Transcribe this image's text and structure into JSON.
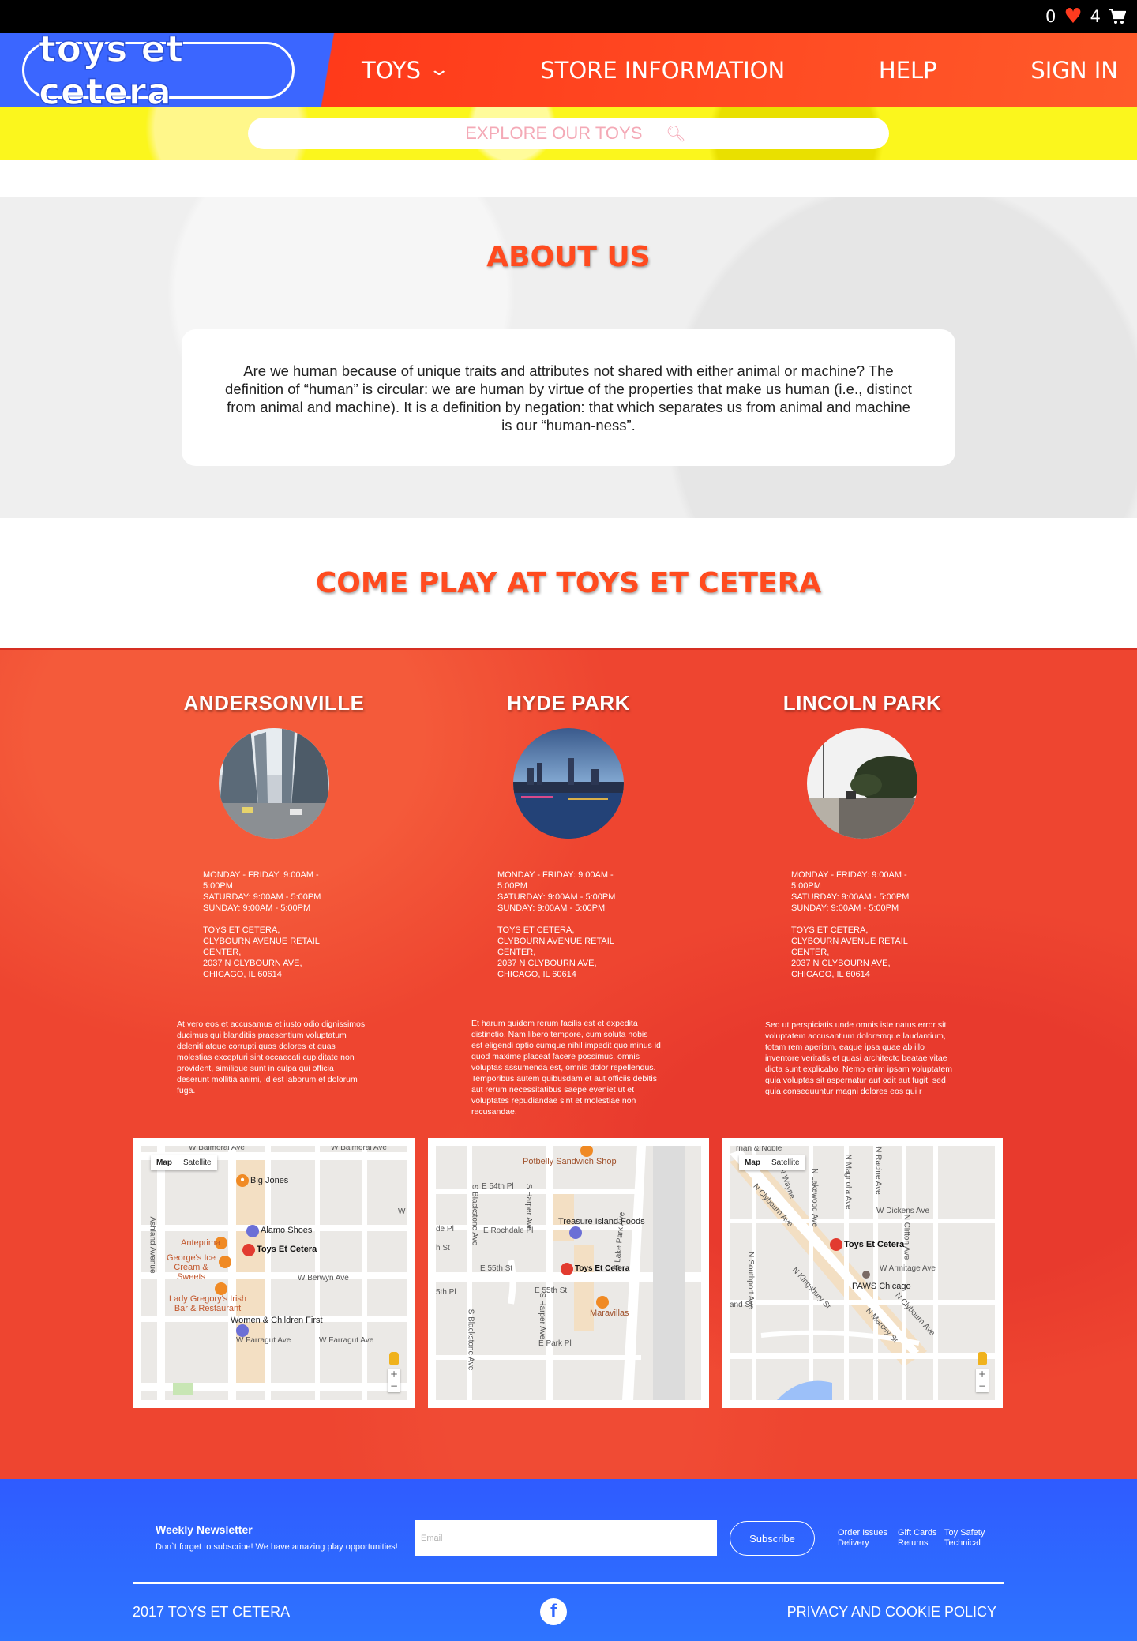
{
  "topbar": {
    "wishlist_count": "0",
    "cart_count": "4",
    "heart_icon": "heart-icon",
    "cart_icon": "cart-icon"
  },
  "header": {
    "logo_text": "toys et cetera",
    "nav": [
      {
        "label": "TOYS",
        "has_dropdown": true
      },
      {
        "label": "STORE INFORMATION"
      },
      {
        "label": "HELP"
      },
      {
        "label": "SIGN IN"
      }
    ],
    "colors": {
      "blue": "#3b66ff",
      "red": "#ff3a1a"
    }
  },
  "search": {
    "placeholder": "EXPLORE OUR TOYS"
  },
  "about": {
    "title": "ABOUT US",
    "body": "Are we human because of unique traits and attributes not shared with either animal or machine? The definition of “human” is circular: we are human by virtue of the properties that make us human (i.e., distinct from animal and machine). It is a definition by negation: that which separates us from animal and machine is our “human-ness”."
  },
  "come_play": {
    "title": "COME PLAY AT TOYS ET CETERA"
  },
  "stores": [
    {
      "name": "ANDERSONVILLE",
      "hours": [
        "MONDAY - FRIDAY: 9:00AM - 5:00PM",
        "SATURDAY: 9:00AM - 5:00PM",
        "SUNDAY: 9:00AM - 5:00PM"
      ],
      "address": [
        "TOYS ET CETERA,",
        "CLYBOURN AVENUE RETAIL CENTER,",
        "2037 N CLYBOURN AVE,",
        "CHICAGO, IL 60614"
      ],
      "description": "At vero eos et accusamus et iusto odio dignissimos ducimus qui blanditiis praesentium voluptatum deleniti atque corrupti quos dolores et quas molestias excepturi sint occaecati cupiditate non provident, similique sunt in culpa qui officia deserunt mollitia animi, id est laborum et dolorum fuga.",
      "map": {
        "tabs": [
          "Map",
          "Satellite"
        ],
        "labels": [
          "W Balmoral Ave",
          "W Balmoral Ave",
          "Big Jones",
          "Alamo Shoes",
          "Toys Et Cetera",
          "Anteprima",
          "George's Ice Cream & Sweets",
          "W Berwyn Ave",
          "Lady Gregory's Irish Bar & Restaurant",
          "Women & Children First",
          "W Farragut Ave",
          "W Farragut Ave",
          "Ashland Avenue",
          "W S"
        ]
      }
    },
    {
      "name": "HYDE PARK",
      "hours": [
        "MONDAY - FRIDAY: 9:00AM - 5:00PM",
        "SATURDAY: 9:00AM - 5:00PM",
        "SUNDAY: 9:00AM - 5:00PM"
      ],
      "address": [
        "TOYS ET CETERA,",
        "CLYBOURN AVENUE RETAIL CENTER,",
        "2037 N CLYBOURN AVE,",
        "CHICAGO, IL 60614"
      ],
      "description": "Et harum quidem rerum facilis est et expedita distinctio. Nam libero tempore, cum soluta nobis est eligendi optio cumque nihil impedit quo minus id quod maxime placeat facere possimus, omnis voluptas assumenda est, omnis dolor repellendus. Temporibus autem quibusdam et aut officiis debitis aut rerum necessitatibus saepe eveniet ut et voluptates repudiandae sint et molestiae non recusandae.",
      "map": {
        "labels": [
          "Potbelly Sandwich Shop",
          "E 54th Pl",
          "Treasure Island Foods",
          "E Rochdale Pl",
          "E 55th St",
          "Toys Et Cetera",
          "E 55th St",
          "Maravillas",
          "E Park Pl",
          "S Lake Park Ave",
          "S Blackstone Ave",
          "S Harper Ave",
          "S Harper Ave",
          "S Blackstone Ave",
          "5th Pl",
          "h St",
          "de Pl"
        ]
      }
    },
    {
      "name": "LINCOLN PARK",
      "hours": [
        "MONDAY - FRIDAY: 9:00AM - 5:00PM",
        "SATURDAY: 9:00AM - 5:00PM",
        "SUNDAY: 9:00AM - 5:00PM"
      ],
      "address": [
        "TOYS ET CETERA,",
        "CLYBOURN AVENUE RETAIL CENTER,",
        "2037 N CLYBOURN AVE,",
        "CHICAGO, IL 60614"
      ],
      "description": "Sed ut perspiciatis unde omnis iste natus error sit voluptatem accusantium doloremque laudantium, totam rem aperiam, eaque ipsa quae ab illo inventore veritatis et quasi architecto beatae vitae dicta sunt explicabo. Nemo enim ipsam voluptatem quia voluptas sit aspernatur aut odit aut fugit, sed quia consequuntur magni dolores eos qui r",
      "map": {
        "tabs": [
          "Map",
          "Satellite"
        ],
        "labels": [
          "N Clybourn Ave",
          "N Wayne",
          "N Lakewood Ave",
          "N Magnolia Ave",
          "N Racine Ave",
          "W Dickens Ave",
          "Toys Et Cetera",
          "N Clifton Ave",
          "N Southport Ave",
          "N Kingsbury St",
          "W Armitage Ave",
          "PAWS Chicago",
          "and St",
          "N Marcey St",
          "N Clybourn Ave",
          "rnan & Noble"
        ]
      }
    }
  ],
  "footer": {
    "newsletter_title": "Weekly Newsletter",
    "newsletter_sub": "Don`t forget to subscribe! We have amazing play opportunities!",
    "email_placeholder": "Email",
    "subscribe_label": "Subscribe",
    "links": [
      "Order Issues",
      "Gift Cards",
      "Toy Safety",
      "Delivery",
      "Returns",
      "Technical"
    ],
    "copyright": "2017 TOYS ET CETERA",
    "privacy": "PRIVACY AND COOKIE POLICY",
    "facebook_icon": "facebook-icon"
  }
}
